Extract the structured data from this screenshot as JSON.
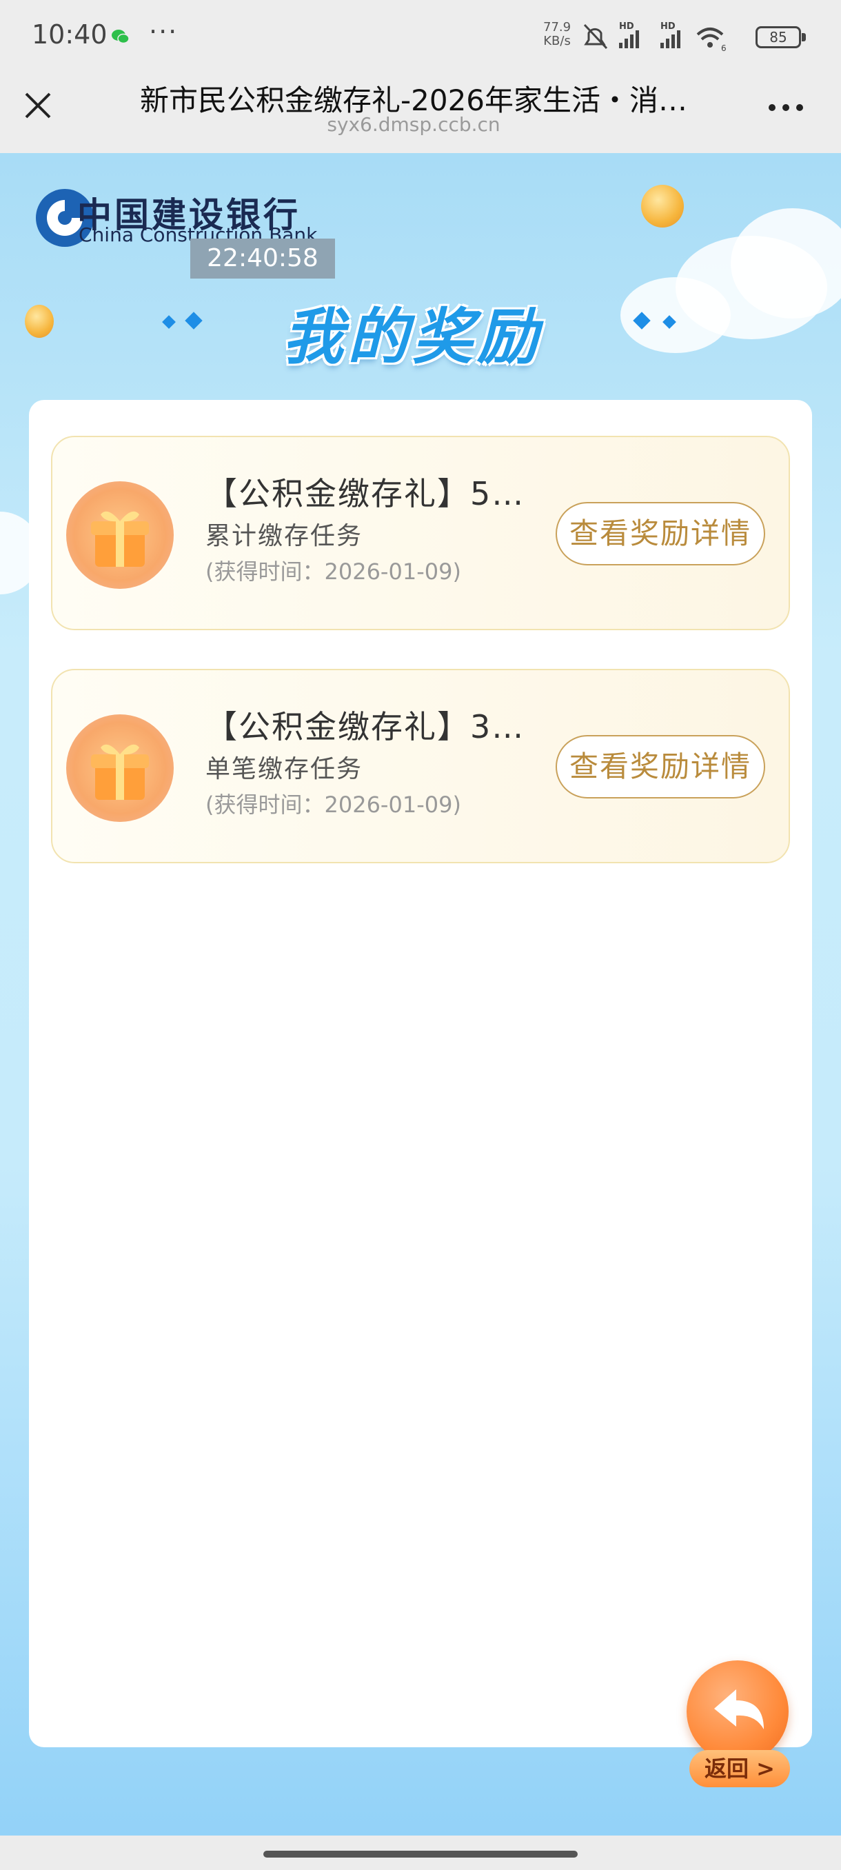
{
  "status_bar": {
    "time": "10:40",
    "dots": "···",
    "net_speed_value": "77.9",
    "net_speed_unit": "KB/s",
    "hd1": "HD",
    "hd2": "HD",
    "wifi_badge": "6",
    "battery": "85"
  },
  "title_bar": {
    "title": "新市民公积金缴存礼-2026年家生活・消…",
    "url": "syx6.dmsp.ccb.cn"
  },
  "page": {
    "bank_name_cn": "中国建设银行",
    "bank_name_en": "China Construction Bank",
    "timestamp": "22:40:58",
    "heading": "我的奖励"
  },
  "rewards": [
    {
      "title": "【公积金缴存礼】5…",
      "task": "累计缴存任务",
      "time": "(获得时间：2026-01-09)",
      "button": "查看奖励详情"
    },
    {
      "title": "【公积金缴存礼】3…",
      "task": "单笔缴存任务",
      "time": "(获得时间：2026-01-09)",
      "button": "查看奖励详情"
    }
  ],
  "back_button": {
    "label": "返回 >"
  },
  "colors": {
    "accent_blue": "#1f9ae8",
    "button_gold": "#b98b3c",
    "back_orange": "#ff8a3a"
  }
}
